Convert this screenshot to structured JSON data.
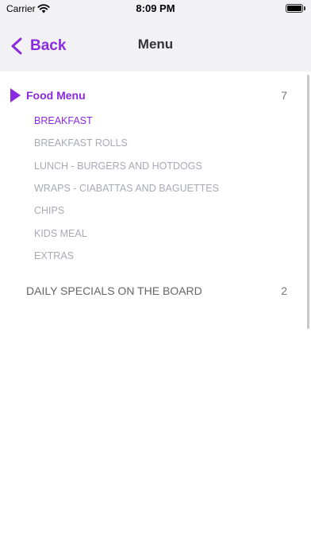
{
  "status_bar": {
    "carrier": "Carrier",
    "time": "8:09 PM"
  },
  "nav": {
    "back_label": "Back",
    "title": "Menu"
  },
  "sections": [
    {
      "title": "Food Menu",
      "count": "7",
      "expanded": true,
      "items": [
        {
          "label": "BREAKFAST",
          "selected": true
        },
        {
          "label": "BREAKFAST ROLLS",
          "selected": false
        },
        {
          "label": "LUNCH - BURGERS AND HOTDOGS",
          "selected": false
        },
        {
          "label": "WRAPS - CIABATTAS AND BAGUETTES",
          "selected": false
        },
        {
          "label": "CHIPS",
          "selected": false
        },
        {
          "label": "KIDS MEAL",
          "selected": false
        },
        {
          "label": "EXTRAS",
          "selected": false
        }
      ]
    },
    {
      "title": "DAILY SPECIALS ON THE BOARD",
      "count": "2",
      "expanded": false
    }
  ],
  "colors": {
    "accent": "#8a2be2",
    "inactive_item": "#a9a9b8",
    "nav_background": "#f2f2f4"
  }
}
